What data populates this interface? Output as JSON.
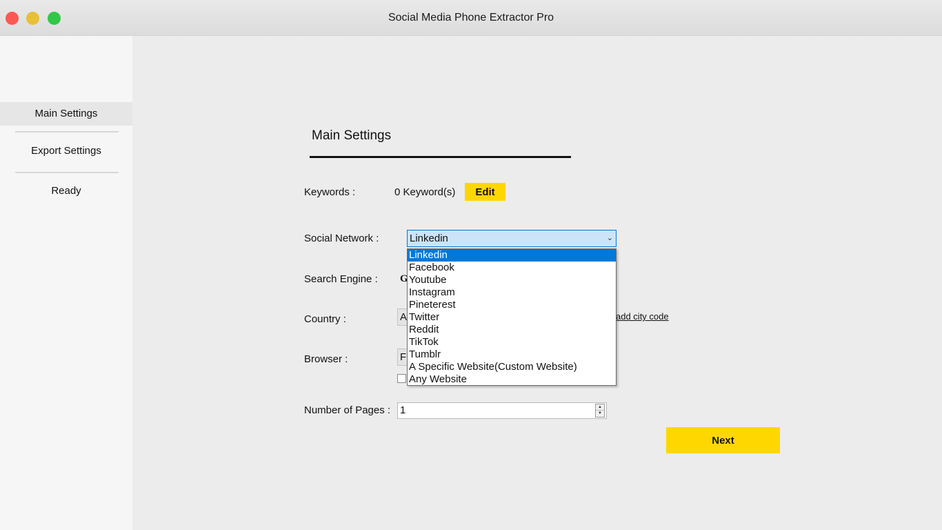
{
  "window": {
    "title": "Social Media Phone Extractor Pro"
  },
  "sidebar": {
    "items": [
      {
        "label": "Main Settings"
      },
      {
        "label": "Export Settings"
      },
      {
        "label": "Ready"
      }
    ]
  },
  "main": {
    "section_title": "Main Settings",
    "keywords": {
      "label": "Keywords :",
      "count_text": "0 Keyword(s)",
      "edit_label": "Edit"
    },
    "social_network": {
      "label": "Social Network :",
      "selected": "Linkedin",
      "options": [
        "Linkedin",
        "Facebook",
        "Youtube",
        "Instagram",
        "Pineterest",
        "Twitter",
        "Reddit",
        "TikTok",
        "Tumblr",
        "A Specific Website(Custom Website)",
        "Any Website"
      ]
    },
    "search_engine": {
      "label": "Search Engine :",
      "value_partial": "G"
    },
    "country": {
      "label": "Country :",
      "value_partial": "A",
      "city_link": "add city code"
    },
    "browser": {
      "label": "Browser :",
      "value_partial": "F"
    },
    "pages": {
      "label": "Number of Pages :",
      "value": "1"
    },
    "next_label": "Next"
  },
  "colors": {
    "accent_yellow": "#ffd700",
    "selection_blue": "#0078d7",
    "combo_bg": "#cce4f7"
  }
}
